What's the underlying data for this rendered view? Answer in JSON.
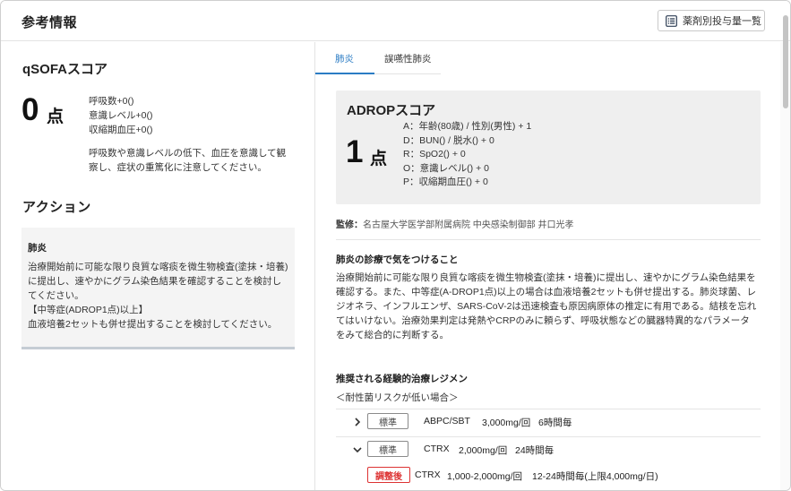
{
  "header": {
    "title": "参考情報",
    "dose_list_button": "薬剤別投与量一覧"
  },
  "qsofa": {
    "title": "qSOFAスコア",
    "score": "0",
    "unit": "点",
    "items": [
      "呼吸数+0()",
      "意識レベル+0()",
      "収縮期血圧+0()"
    ],
    "note": "呼吸数や意識レベルの低下、血圧を意識して観察し、症状の重篤化に注意してください。"
  },
  "action": {
    "title": "アクション",
    "box_title": "肺炎",
    "lines": [
      "治療開始前に可能な限り良質な喀痰を微生物検査(塗抹・培養)に提出し、速やかにグラム染色結果を確認することを検討してください。",
      "【中等症(ADROP1点)以上】",
      "血液培養2セットも併せ提出することを検討してください。"
    ]
  },
  "tabs": [
    {
      "label": "肺炎",
      "active": true
    },
    {
      "label": "誤嚥性肺炎",
      "active": false
    }
  ],
  "adrop": {
    "title": "ADROPスコア",
    "score": "1",
    "unit": "点",
    "items": [
      "A：年齢(80歳) / 性別(男性) + 1",
      "D：BUN() / 脱水() + 0",
      "R：SpO2() + 0",
      "O：意識レベル() + 0",
      "P：収縮期血圧() + 0"
    ]
  },
  "supervision": {
    "label": "監修：",
    "text": "名古屋大学医学部附属病院 中央感染制御部 井口光孝"
  },
  "careful": {
    "title": "肺炎の診療で気をつけること",
    "text": "治療開始前に可能な限り良質な喀痰を微生物検査(塗抹・培養)に提出し、速やかにグラム染色結果を確認する。また、中等症(A-DROP1点)以上の場合は血液培養2セットも併せ提出する。肺炎球菌、レジオネラ、インフルエンザ、SARS-CoV-2は迅速検査も原因病原体の推定に有用である。結核を忘れてはいけない。治療効果判定は発熱やCRPのみに頼らず、呼吸状態などの臓器特異的なパラメータをみて総合的に判断する。"
  },
  "regimen": {
    "title": "推奨される経験的治療レジメン",
    "subtitle": "＜耐性菌リスクが低い場合＞",
    "rows": [
      {
        "badge": "標準",
        "drug": "ABPC/SBT",
        "dose": "3,000mg/回",
        "freq": "6時間毎",
        "expanded": false
      },
      {
        "badge": "標準",
        "drug": "CTRX",
        "dose": "2,000mg/回",
        "freq": "24時間毎",
        "expanded": true
      }
    ],
    "adjusted": {
      "badge": "調整後",
      "drug": "CTRX",
      "dose": "1,000-2,000mg/回",
      "freq": "12-24時間毎(上限4,000mg/日)"
    }
  },
  "colors": {
    "accent": "#2b7cc4",
    "adjust_badge": "#d33333",
    "box_bg": "#efefef"
  }
}
